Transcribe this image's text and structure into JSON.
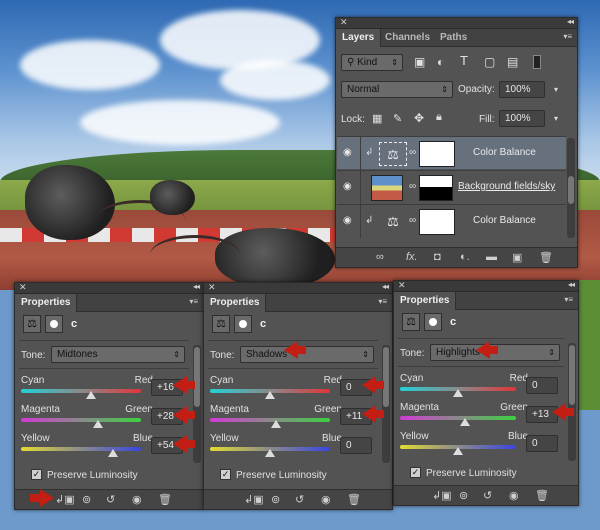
{
  "layers_panel": {
    "tabs": [
      "Layers",
      "Channels",
      "Paths"
    ],
    "filter_label": "Kind",
    "blend_mode": "Normal",
    "opacity_label": "Opacity:",
    "opacity_value": "100%",
    "lock_label": "Lock:",
    "fill_label": "Fill:",
    "fill_value": "100%",
    "layers": [
      {
        "name": "Color Balance",
        "selected": true
      },
      {
        "name": "Background fields/sky",
        "selected": false
      },
      {
        "name": "Color Balance",
        "selected": false
      }
    ]
  },
  "properties_panels": [
    {
      "title": "Properties",
      "label": "c",
      "tone_label": "Tone:",
      "tone": "Midtones",
      "sliders": [
        {
          "left": "Cyan",
          "right": "Red",
          "value": "+16",
          "fraction": 0.58
        },
        {
          "left": "Magenta",
          "right": "Green",
          "value": "+28",
          "fraction": 0.64
        },
        {
          "left": "Yellow",
          "right": "Blue",
          "value": "+54",
          "fraction": 0.77
        }
      ],
      "preserve_luminosity": "Preserve Luminosity"
    },
    {
      "title": "Properties",
      "label": "c",
      "tone_label": "Tone:",
      "tone": "Shadows",
      "sliders": [
        {
          "left": "Cyan",
          "right": "Red",
          "value": "0",
          "fraction": 0.5
        },
        {
          "left": "Magenta",
          "right": "Green",
          "value": "+11",
          "fraction": 0.55
        },
        {
          "left": "Yellow",
          "right": "Blue",
          "value": "0",
          "fraction": 0.5
        }
      ],
      "preserve_luminosity": "Preserve Luminosity"
    },
    {
      "title": "Properties",
      "label": "c",
      "tone_label": "Tone:",
      "tone": "Highlights",
      "sliders": [
        {
          "left": "Cyan",
          "right": "Red",
          "value": "0",
          "fraction": 0.5
        },
        {
          "left": "Magenta",
          "right": "Green",
          "value": "+13",
          "fraction": 0.56
        },
        {
          "left": "Yellow",
          "right": "Blue",
          "value": "0",
          "fraction": 0.5
        }
      ],
      "preserve_luminosity": "Preserve Luminosity"
    }
  ],
  "colors": {
    "panel_bg": "#535353",
    "selected_layer": "#67707d",
    "annotation_arrow": "#c21e14"
  }
}
